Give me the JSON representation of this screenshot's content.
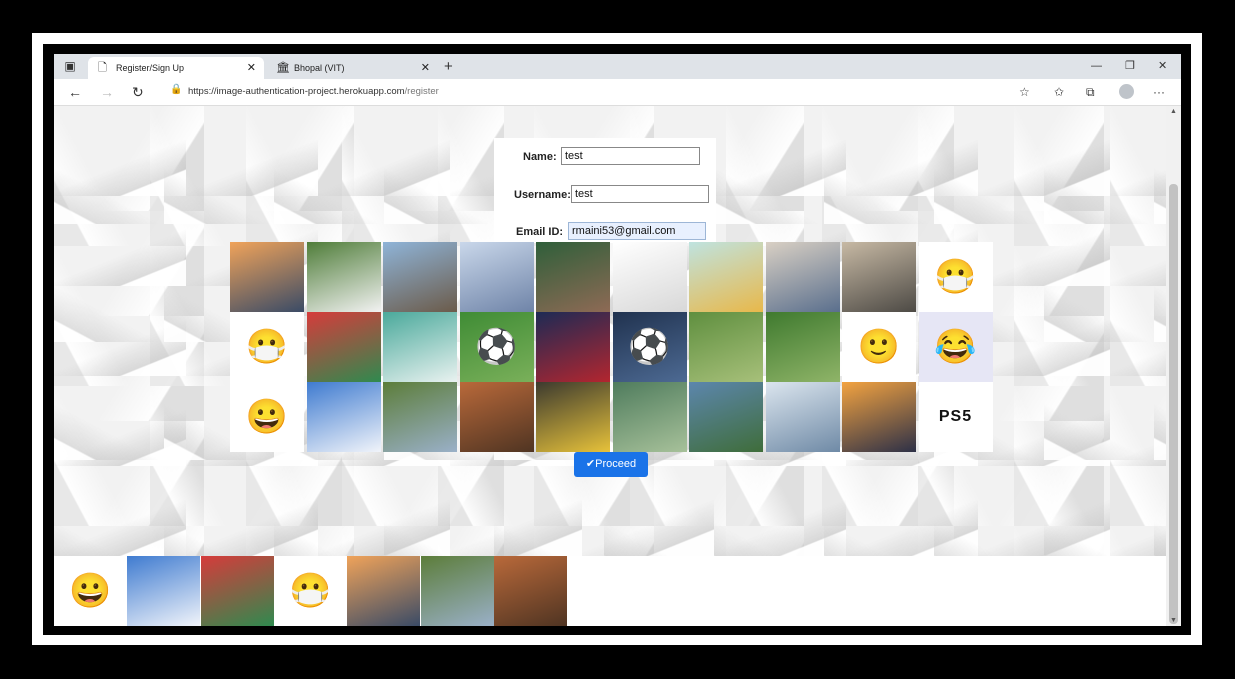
{
  "browser": {
    "tabs": [
      {
        "title": "Register/Sign Up",
        "icon": "page-icon",
        "active": true
      },
      {
        "title": "Bhopal (VIT)",
        "icon": "college-icon",
        "active": false
      }
    ],
    "url_domain": "https://image-authentication-project.herokuapp.com",
    "url_path": "/register"
  },
  "form": {
    "name_label": "Name:",
    "name_value": "test",
    "username_label": "Username:",
    "username_value": "test",
    "email_label": "Email ID:",
    "email_value": "rmaini53@gmail.com"
  },
  "grid": {
    "tiles": [
      {
        "id": "pier-sunset",
        "colors": [
          "#f0a35a",
          "#3a4b66"
        ]
      },
      {
        "id": "white-dog",
        "colors": [
          "#4f7d39",
          "#f2f2f2"
        ]
      },
      {
        "id": "house",
        "colors": [
          "#8fb4d8",
          "#6b5b4a"
        ]
      },
      {
        "id": "airplane-sky",
        "colors": [
          "#c9d7ea",
          "#6f84a8"
        ]
      },
      {
        "id": "soccer-stadium-phone",
        "colors": [
          "#2f5f3a",
          "#8e6a55"
        ]
      },
      {
        "id": "clock-doodle",
        "colors": [
          "#ffffff",
          "#d8d8d8"
        ]
      },
      {
        "id": "education-books",
        "colors": [
          "#bfe3e0",
          "#e8b84a"
        ]
      },
      {
        "id": "open-book-pencil",
        "colors": [
          "#d9d0c4",
          "#5a6f8d"
        ]
      },
      {
        "id": "writing-desk",
        "colors": [
          "#c7b9a4",
          "#4d4a45"
        ]
      },
      {
        "id": "masked-faces",
        "colors": [
          "#ffffff",
          "#ffffff"
        ]
      },
      {
        "id": "masked-man",
        "colors": [
          "#ffffff",
          "#ffffff"
        ]
      },
      {
        "id": "badminton-tokyo",
        "colors": [
          "#d63b3b",
          "#2f8a4f"
        ]
      },
      {
        "id": "shuttlecock",
        "colors": [
          "#4aa99b",
          "#e9f2f0"
        ]
      },
      {
        "id": "soccer-ball-grass",
        "colors": [
          "#3f8c35",
          "#7ab05a"
        ]
      },
      {
        "id": "soccer-players",
        "colors": [
          "#1d2a55",
          "#b3262f"
        ]
      },
      {
        "id": "soccer-ball-net",
        "colors": [
          "#20324f",
          "#4d6a93"
        ]
      },
      {
        "id": "cricket-wicket",
        "colors": [
          "#5f8f3f",
          "#a7c07a"
        ]
      },
      {
        "id": "cricket-bat-ball",
        "colors": [
          "#3f7a2f",
          "#8fb468"
        ]
      },
      {
        "id": "smiley-emoji",
        "colors": [
          "#ffffff",
          "#ffffff"
        ]
      },
      {
        "id": "emoji-set",
        "colors": [
          "#e6e6f5",
          "#e6e6f5"
        ]
      },
      {
        "id": "thumbs-up-smiley",
        "colors": [
          "#ffffff",
          "#ffffff"
        ]
      },
      {
        "id": "rainbow-clouds",
        "colors": [
          "#3f7bd0",
          "#f1f4fa"
        ]
      },
      {
        "id": "forest-river",
        "colors": [
          "#5c7d3a",
          "#9ab0c8"
        ]
      },
      {
        "id": "white-horse",
        "colors": [
          "#b9693a",
          "#4f3422"
        ]
      },
      {
        "id": "yellow-birds",
        "colors": [
          "#3c3a2f",
          "#e7c23a"
        ]
      },
      {
        "id": "green-bird",
        "colors": [
          "#4f7c5d",
          "#a7c19a"
        ]
      },
      {
        "id": "green-mountains",
        "colors": [
          "#5c86ad",
          "#3f6d3a"
        ]
      },
      {
        "id": "misty-peak",
        "colors": [
          "#dbe5ee",
          "#6f8aa6"
        ]
      },
      {
        "id": "plane-sunset",
        "colors": [
          "#f3a340",
          "#2d3047"
        ]
      },
      {
        "id": "ps5-logo",
        "colors": [
          "#ffffff",
          "#ffffff"
        ]
      }
    ],
    "ps5_text": "PS5"
  },
  "proceed_label": "Proceed",
  "selected": {
    "tiles": [
      {
        "id": "thumbs-up-smiley",
        "colors": [
          "#ffffff",
          "#ffffff"
        ]
      },
      {
        "id": "rainbow-clouds",
        "colors": [
          "#3f7bd0",
          "#f1f4fa"
        ]
      },
      {
        "id": "badminton-tokyo",
        "colors": [
          "#d63b3b",
          "#2f8a4f"
        ]
      },
      {
        "id": "masked-man",
        "colors": [
          "#ffffff",
          "#ffffff"
        ]
      },
      {
        "id": "pier-sunset",
        "colors": [
          "#f0a35a",
          "#3a4b66"
        ]
      },
      {
        "id": "forest-river",
        "colors": [
          "#5c7d3a",
          "#9ab0c8"
        ]
      },
      {
        "id": "white-horse",
        "colors": [
          "#b9693a",
          "#4f3422"
        ]
      }
    ]
  },
  "colors": {
    "accent": "#1a73e8",
    "autofill": "#e8f0fe"
  }
}
